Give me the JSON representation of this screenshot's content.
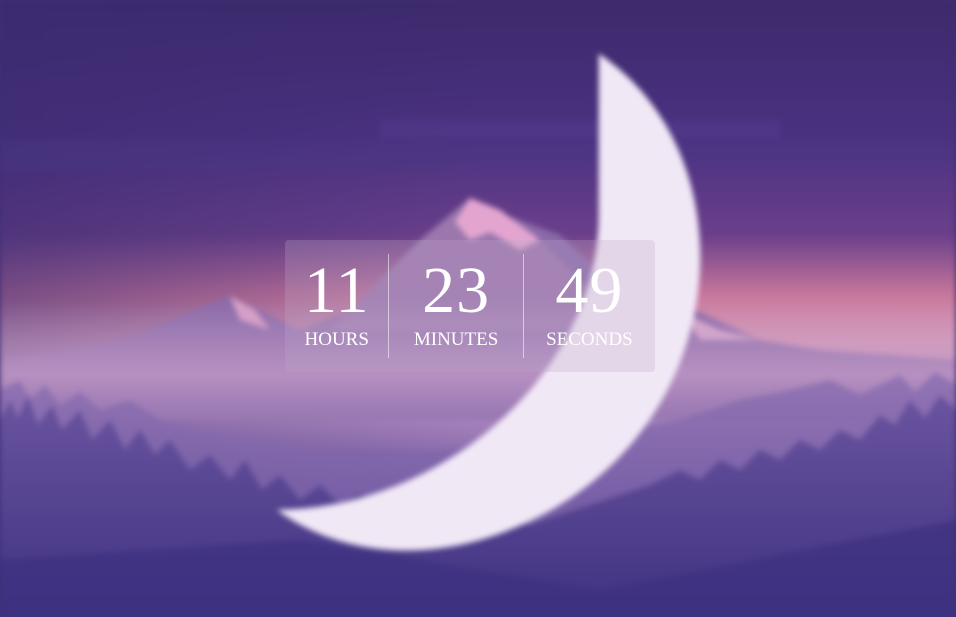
{
  "countdown": {
    "hours": {
      "value": "11",
      "label": "HOURS"
    },
    "minutes": {
      "value": "23",
      "label": "MINUTES"
    },
    "seconds": {
      "value": "49",
      "label": "SECONDS"
    }
  },
  "colors": {
    "sky_top": "#3f2c6e",
    "sky_glow": "#d8849f",
    "mist": "#b690c0",
    "forest": "#4b3a84",
    "text": "#ffffff"
  }
}
